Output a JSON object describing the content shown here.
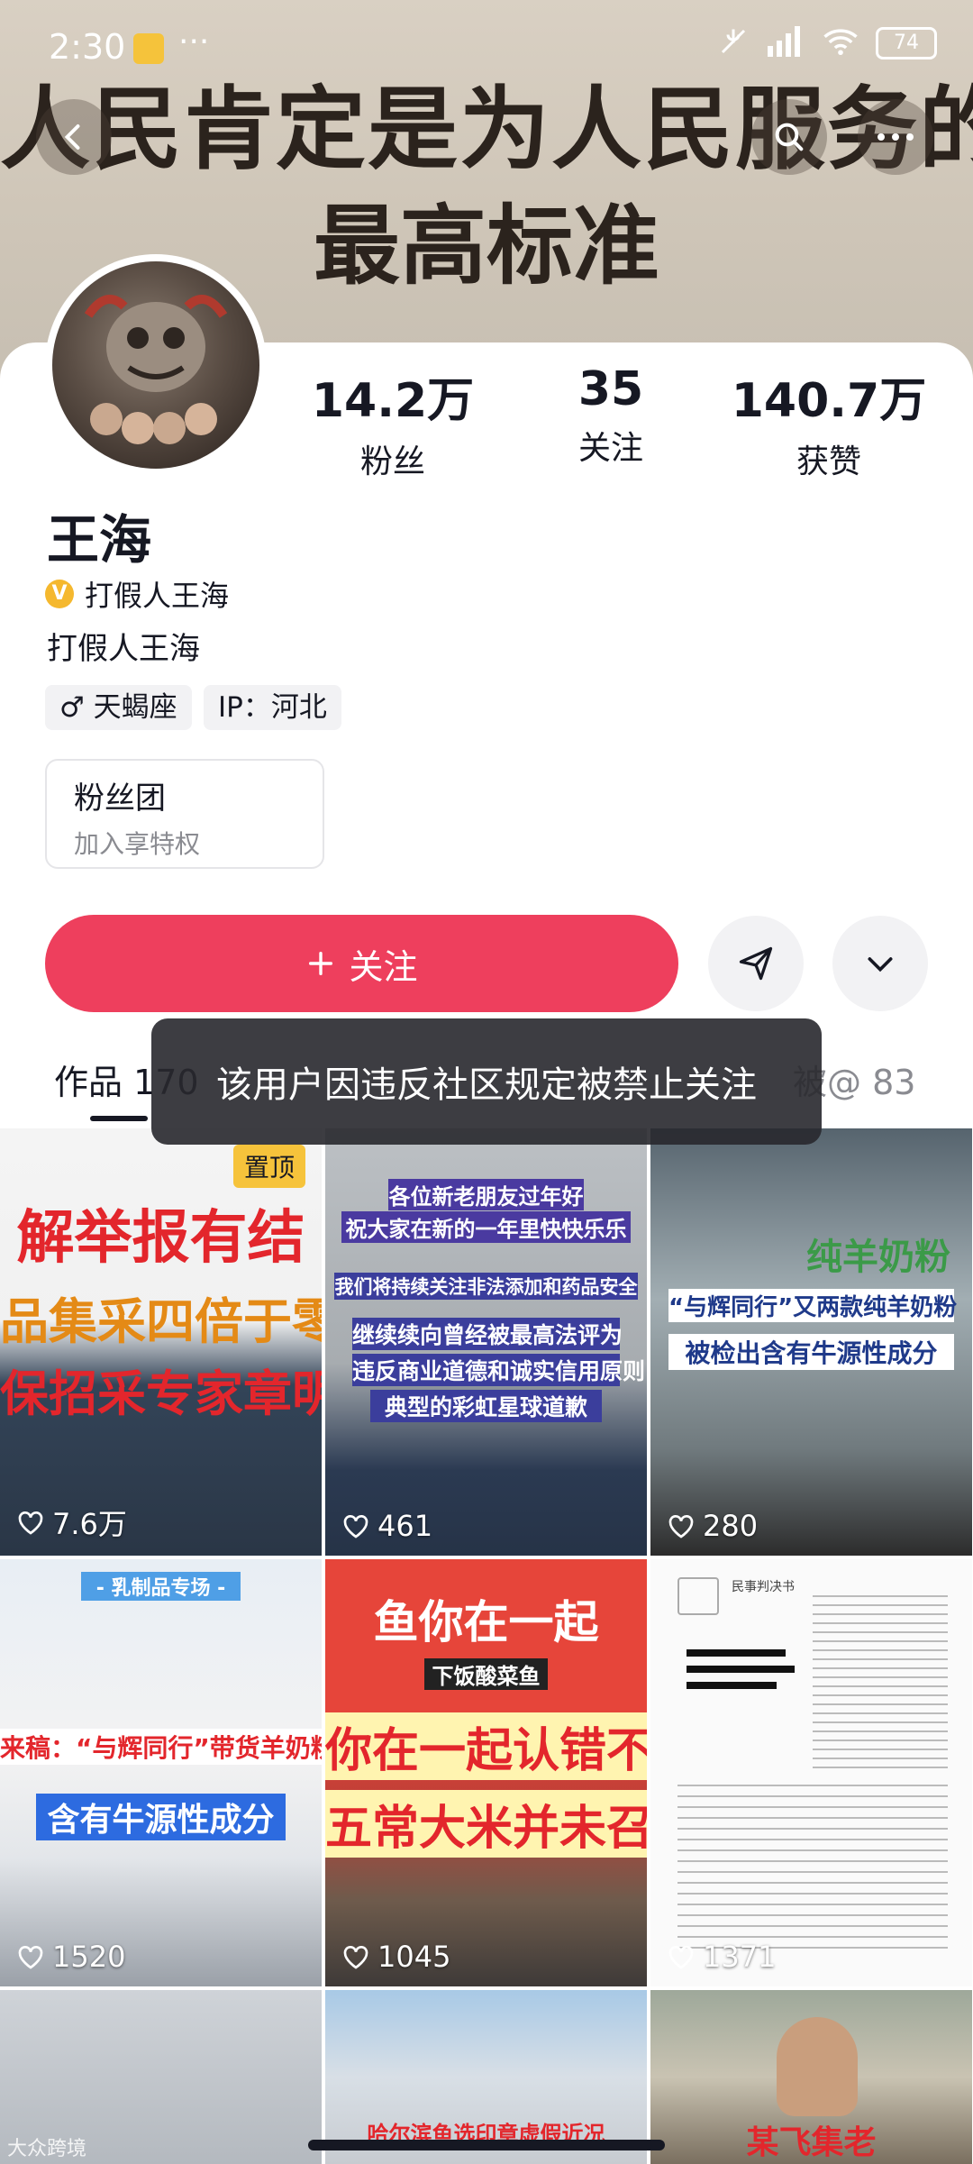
{
  "status_bar": {
    "time": "2:30",
    "battery": "74"
  },
  "banner": {
    "line1": "人民肯定是为人民服务的",
    "line2": "最高标准"
  },
  "stats": [
    {
      "num": "14.2万",
      "label": "粉丝"
    },
    {
      "num": "35",
      "label": "关注"
    },
    {
      "num": "140.7万",
      "label": "获赞"
    }
  ],
  "profile": {
    "name": "王海",
    "verified_label": "打假人王海",
    "bio": "打假人王海",
    "tags": [
      "♂ 天蝎座",
      "IP：河北"
    ]
  },
  "fans_group": {
    "title": "粉丝团",
    "subtitle": "加入享特权"
  },
  "actions": {
    "follow_label": "关注"
  },
  "tabs": {
    "works": "作品 170",
    "mentions": "被@ 83"
  },
  "toast": "该用户因违反社区规定被禁止关注",
  "grid": [
    {
      "pin": "置顶",
      "lines": [
        "解举报有结",
        "品集采四倍于零售",
        "保招采专家章明"
      ],
      "likes": "7.6万"
    },
    {
      "lines": [
        "各位新老朋友过年好",
        "祝大家在新的一年里快快乐乐",
        "我们将持续关注非法添加和药品安全",
        "继续续向曾经被最高法评为",
        "违反商业道德和诚实信用原则",
        "典型的彩虹星球道歉"
      ],
      "likes": "461"
    },
    {
      "lines": [
        "纯羊奶粉",
        "“与辉同行”又两款纯羊奶粉",
        "被检出含有牛源性成分"
      ],
      "likes": "280"
    },
    {
      "lines": [
        "- 乳制品专场 -",
        "来稿：“与辉同行”带货羊奶粉",
        "含有牛源性成分"
      ],
      "likes": "1520"
    },
    {
      "lines": [
        "鱼你在一起",
        "下饭酸菜鱼",
        "你在一起认错不",
        "五常大米并未召"
      ],
      "likes": "1045"
    },
    {
      "lines": [
        "民事判决书"
      ],
      "likes": "1371"
    },
    {
      "lines": [],
      "likes": ""
    },
    {
      "lines": [
        "哈尔滨鱼选印章虚假近况"
      ],
      "likes": ""
    },
    {
      "lines": [
        "某飞集老"
      ],
      "likes": ""
    }
  ],
  "watermark": "大众跨境"
}
